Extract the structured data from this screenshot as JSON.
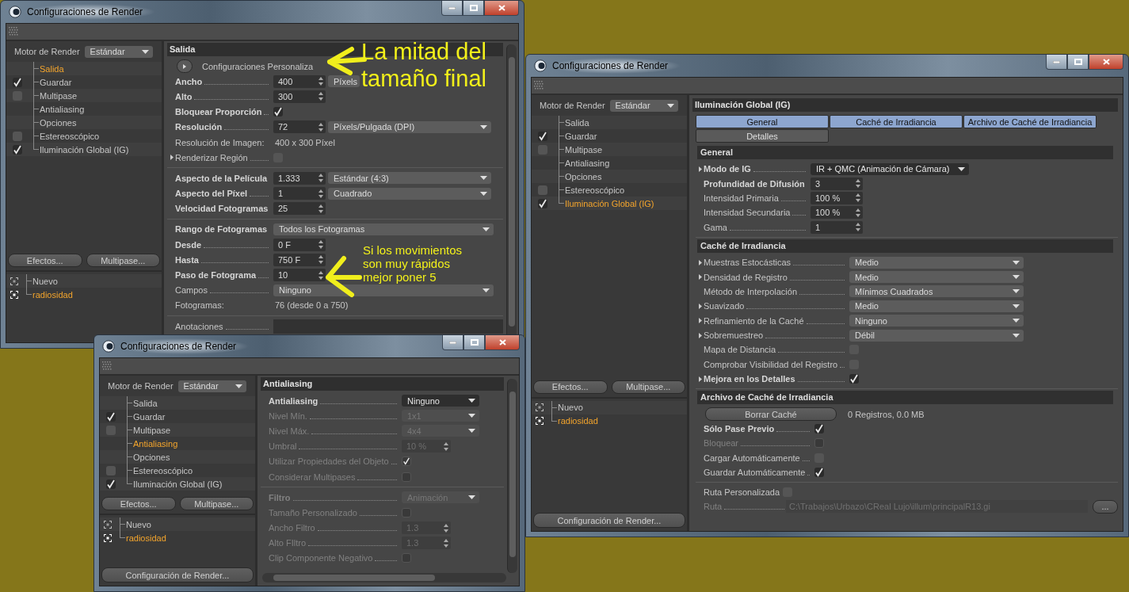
{
  "windows": [
    {
      "title": "Configuraciones de Render",
      "engine": {
        "label": "Motor de Render",
        "value": "Estándar"
      },
      "tree": [
        {
          "label": "Salida",
          "kind": "plain",
          "selected": true
        },
        {
          "label": "Guardar",
          "kind": "check",
          "checked": true,
          "selected": false
        },
        {
          "label": "Multipase",
          "kind": "check",
          "checked": false,
          "selected": false
        },
        {
          "label": "Antialiasing",
          "kind": "plain",
          "selected": false
        },
        {
          "label": "Opciones",
          "kind": "plain",
          "selected": false
        },
        {
          "label": "Estereoscópico",
          "kind": "check",
          "checked": false,
          "selected": false
        },
        {
          "label": "Iluminación Global (IG)",
          "kind": "check",
          "checked": true,
          "selected": false
        }
      ],
      "buttons": [
        "Efectos...",
        "Multipase..."
      ],
      "presets": [
        {
          "label": "Nuevo",
          "selected": false
        },
        {
          "label": "radiosidad",
          "selected": true
        }
      ],
      "panel": {
        "title": "Salida",
        "groups": [
          {
            "rows": [
              {
                "kind": "preset",
                "label": "Configuraciones Personaliza",
                "bold": false,
                "expander": false,
                "disabled": false
              },
              {
                "kind": "number_select",
                "label": "Ancho",
                "value": "400",
                "option": "Píxels",
                "bold": true,
                "expander": false,
                "disabled": false
              },
              {
                "kind": "number",
                "label": "Alto",
                "value": "300",
                "bold": true,
                "expander": false,
                "disabled": false
              },
              {
                "kind": "check",
                "label": "Bloquear Proporción",
                "checked": true,
                "bold": true,
                "expander": false,
                "disabled": false
              },
              {
                "kind": "number_select",
                "label": "Resolución",
                "value": "72",
                "option": "Píxels/Pulgada (DPI)",
                "bold": true,
                "expander": false,
                "disabled": false
              },
              {
                "kind": "info",
                "label": "Resolución de Imagen:",
                "value": "400 x 300 Píxel",
                "bold": false,
                "expander": false,
                "disabled": false
              },
              {
                "kind": "check",
                "label": "Renderizar Región",
                "checked": false,
                "bold": false,
                "expander": true,
                "disabled": false
              }
            ]
          },
          {
            "rows": [
              {
                "kind": "number_select",
                "label": "Aspecto de la Película",
                "value": "1.333",
                "option": "Estándar (4:3)",
                "bold": true,
                "expander": false,
                "disabled": false
              },
              {
                "kind": "number_select",
                "label": "Aspecto del Píxel",
                "value": "1",
                "option": "Cuadrado",
                "bold": true,
                "expander": false,
                "disabled": false
              },
              {
                "kind": "number",
                "label": "Velocidad Fotogramas",
                "value": "25",
                "bold": true,
                "expander": false,
                "disabled": false
              }
            ]
          },
          {
            "rows": [
              {
                "kind": "select",
                "label": "Rango de Fotogramas",
                "option": "Todos los Fotogramas",
                "bold": true,
                "expander": false,
                "disabled": false
              },
              {
                "kind": "number",
                "label": "Desde",
                "value": "0 F",
                "bold": true,
                "expander": false,
                "disabled": false
              },
              {
                "kind": "number",
                "label": "Hasta",
                "value": "750 F",
                "bold": true,
                "expander": false,
                "disabled": false
              },
              {
                "kind": "number",
                "label": "Paso de Fotograma",
                "value": "10",
                "bold": true,
                "expander": false,
                "disabled": false
              },
              {
                "kind": "select",
                "label": "Campos",
                "option": "Ninguno",
                "bold": false,
                "expander": false,
                "disabled": false
              },
              {
                "kind": "info",
                "label": "Fotogramas:",
                "value": "76 (desde 0 a 750)",
                "bold": false,
                "expander": false,
                "disabled": false
              }
            ]
          },
          {
            "rows": [
              {
                "kind": "text_field",
                "label": "Anotaciones",
                "bold": false,
                "expander": false,
                "disabled": false
              }
            ]
          }
        ]
      }
    },
    {
      "title": "Configuraciones de Render",
      "engine": {
        "label": "Motor de Render",
        "value": "Estándar"
      },
      "tree": [
        {
          "label": "Salida",
          "kind": "plain",
          "selected": false
        },
        {
          "label": "Guardar",
          "kind": "check",
          "checked": true,
          "selected": false
        },
        {
          "label": "Multipase",
          "kind": "check",
          "checked": false,
          "selected": false
        },
        {
          "label": "Antialiasing",
          "kind": "plain",
          "selected": true
        },
        {
          "label": "Opciones",
          "kind": "plain",
          "selected": false
        },
        {
          "label": "Estereoscópico",
          "kind": "check",
          "checked": false,
          "selected": false
        },
        {
          "label": "Iluminación Global (IG)",
          "kind": "check",
          "checked": true,
          "selected": false
        }
      ],
      "buttons": [
        "Efectos...",
        "Multipase..."
      ],
      "presets": [
        {
          "label": "Nuevo",
          "selected": false
        },
        {
          "label": "radiosidad",
          "selected": true
        }
      ],
      "bottom_button": "Configuración de Render...",
      "panel": {
        "title": "Antialiasing",
        "groups": [
          {
            "rows": [
              {
                "kind": "select",
                "label": "Antialiasing",
                "option": "Ninguno",
                "bold": true,
                "expander": false,
                "disabled": false
              },
              {
                "kind": "select",
                "label": "Nivel Mín.",
                "option": "1x1",
                "bold": false,
                "expander": false,
                "disabled": true
              },
              {
                "kind": "select",
                "label": "Nivel Máx.",
                "option": "4x4",
                "bold": false,
                "expander": false,
                "disabled": true
              },
              {
                "kind": "number",
                "label": "Umbral",
                "value": "10 %",
                "bold": false,
                "expander": false,
                "disabled": true
              },
              {
                "kind": "check",
                "label": "Utilizar Propiedades del Objeto",
                "checked": true,
                "bold": false,
                "expander": false,
                "disabled": true
              },
              {
                "kind": "check",
                "label": "Considerar Multipases",
                "checked": false,
                "bold": false,
                "expander": false,
                "disabled": true
              }
            ]
          },
          {
            "rows": [
              {
                "kind": "select",
                "label": "Filtro",
                "option": "Animación",
                "bold": true,
                "expander": false,
                "disabled": true
              },
              {
                "kind": "check",
                "label": "Tamaño Personalizado",
                "checked": false,
                "bold": false,
                "expander": false,
                "disabled": true
              },
              {
                "kind": "number",
                "label": "Ancho Filtro",
                "value": "1.3",
                "bold": false,
                "expander": false,
                "disabled": true
              },
              {
                "kind": "number",
                "label": "Alto FIltro",
                "value": "1.3",
                "bold": false,
                "expander": false,
                "disabled": true
              },
              {
                "kind": "check",
                "label": "Clip Componente Negativo",
                "checked": false,
                "bold": false,
                "expander": false,
                "disabled": true
              }
            ]
          }
        ]
      }
    },
    {
      "title": "Configuraciones de Render",
      "engine": {
        "label": "Motor de Render",
        "value": "Estándar"
      },
      "tree": [
        {
          "label": "Salida",
          "kind": "plain",
          "selected": false
        },
        {
          "label": "Guardar",
          "kind": "check",
          "checked": true,
          "selected": false
        },
        {
          "label": "Multipase",
          "kind": "check",
          "checked": false,
          "selected": false
        },
        {
          "label": "Antialiasing",
          "kind": "plain",
          "selected": false
        },
        {
          "label": "Opciones",
          "kind": "plain",
          "selected": false
        },
        {
          "label": "Estereoscópico",
          "kind": "check",
          "checked": false,
          "selected": false
        },
        {
          "label": "Iluminación Global (IG)",
          "kind": "check",
          "checked": true,
          "selected": true
        }
      ],
      "buttons": [
        "Efectos...",
        "Multipase..."
      ],
      "presets": [
        {
          "label": "Nuevo",
          "selected": false
        },
        {
          "label": "radiosidad",
          "selected": true
        }
      ],
      "bottom_button": "Configuración de Render...",
      "panel": {
        "title": "Iluminación Global (IG)",
        "tabs": [
          {
            "label": "General",
            "selected": true
          },
          {
            "label": "Caché de Irradiancia",
            "selected": true
          },
          {
            "label": "Archivo de Caché de Irradiancia",
            "selected": true
          },
          {
            "label": "Detalles",
            "selected": false
          }
        ],
        "groups": [
          {
            "title": "General",
            "rows": [
              {
                "kind": "select",
                "label": "Modo de IG",
                "option": "IR + QMC (Animación de Cámara)",
                "bold": true,
                "expander": true,
                "disabled": false
              },
              {
                "kind": "number",
                "label": "Profundidad de Difusión",
                "value": "3",
                "bold": true,
                "expander": false,
                "disabled": false
              },
              {
                "kind": "number",
                "label": "Intensidad Primaria",
                "value": "100 %",
                "bold": false,
                "expander": false,
                "disabled": false
              },
              {
                "kind": "number",
                "label": "Intensidad Secundaria",
                "value": "100 %",
                "bold": false,
                "expander": false,
                "disabled": false
              },
              {
                "kind": "number",
                "label": "Gama",
                "value": "1",
                "bold": false,
                "expander": false,
                "disabled": false
              }
            ]
          },
          {
            "title": "Caché de Irradiancia",
            "rows": [
              {
                "kind": "select",
                "label": "Muestras Estocásticas",
                "option": "Medio",
                "bold": false,
                "expander": true,
                "disabled": false
              },
              {
                "kind": "select",
                "label": "Densidad de Registro",
                "option": "Medio",
                "bold": false,
                "expander": true,
                "disabled": false
              },
              {
                "kind": "select",
                "label": "Método de Interpolación",
                "option": "Mínimos Cuadrados",
                "bold": false,
                "expander": false,
                "disabled": false
              },
              {
                "kind": "select",
                "label": "Suavizado",
                "option": "Medio",
                "bold": false,
                "expander": true,
                "disabled": false
              },
              {
                "kind": "select",
                "label": "Refinamiento de la Caché",
                "option": "Ninguno",
                "bold": false,
                "expander": true,
                "disabled": false
              },
              {
                "kind": "select",
                "label": "Sobremuestreo",
                "option": "Débil",
                "bold": false,
                "expander": true,
                "disabled": false
              },
              {
                "kind": "check",
                "label": "Mapa de Distancia",
                "checked": false,
                "bold": false,
                "expander": false,
                "disabled": false
              },
              {
                "kind": "check",
                "label": "Comprobar Visibilidad del Registro",
                "checked": false,
                "bold": false,
                "expander": false,
                "disabled": false
              },
              {
                "kind": "check",
                "label": "Mejora en los Detalles",
                "checked": true,
                "bold": true,
                "expander": true,
                "disabled": false
              }
            ]
          },
          {
            "title": "Archivo de Caché de Irradiancia",
            "rows": [
              {
                "kind": "button_info",
                "button": "Borrar Caché",
                "value": "0 Registros, 0.0 MB",
                "bold": false,
                "expander": false,
                "disabled": false
              },
              {
                "kind": "check",
                "label": "Sólo Pase Previo",
                "checked": true,
                "bold": true,
                "expander": false,
                "disabled": false
              },
              {
                "kind": "check",
                "label": "Bloquear",
                "checked": false,
                "bold": false,
                "expander": false,
                "disabled": true
              },
              {
                "kind": "check",
                "label": "Cargar Automáticamente",
                "checked": false,
                "bold": false,
                "expander": false,
                "disabled": false
              },
              {
                "kind": "check",
                "label": "Guardar Automáticamente",
                "checked": true,
                "bold": false,
                "expander": false,
                "disabled": false
              }
            ]
          },
          {
            "rows": [
              {
                "kind": "check",
                "label": "Ruta Personalizada",
                "checked": false,
                "bold": false,
                "expander": false,
                "disabled": false
              },
              {
                "kind": "path",
                "label": "Ruta",
                "value": "C:\\Trabajos\\Urbazo\\CReal Lujo\\illum\\principalR13.gi",
                "button": "...",
                "bold": false,
                "expander": false,
                "disabled": true
              }
            ]
          }
        ]
      }
    }
  ],
  "annotations": [
    {
      "text": "La mitad del\ntamaño final"
    },
    {
      "text": "Si los movimientos\nson muy rápidos\nmejor poner 5"
    }
  ]
}
